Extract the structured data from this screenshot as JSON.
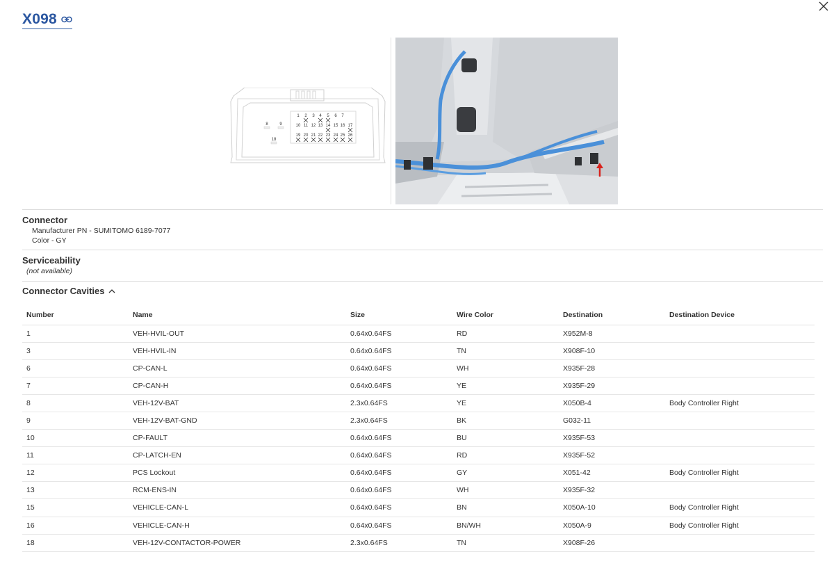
{
  "connector_id": "X098",
  "pinout": {
    "pins_top": [
      "1",
      "2",
      "3",
      "4",
      "5",
      "6",
      "7"
    ],
    "pins_mid": [
      "10",
      "11",
      "12",
      "13",
      "14",
      "15",
      "16",
      "17"
    ],
    "pins_bot": [
      "19",
      "20",
      "21",
      "22",
      "23",
      "24",
      "25",
      "26"
    ],
    "pins_left": [
      "8",
      "9",
      "18"
    ]
  },
  "connector_section": {
    "title": "Connector",
    "manufacturer_pn": "Manufacturer PN - SUMITOMO 6189-7077",
    "color": "Color - GY"
  },
  "serviceability_section": {
    "title": "Serviceability",
    "value": "(not available)"
  },
  "cavities": {
    "title": "Connector Cavities",
    "columns": [
      "Number",
      "Name",
      "Size",
      "Wire Color",
      "Destination",
      "Destination Device"
    ],
    "rows": [
      {
        "number": "1",
        "name": "VEH-HVIL-OUT",
        "size": "0.64x0.64FS",
        "wire_color": "RD",
        "destination": "X952M-8",
        "device": ""
      },
      {
        "number": "3",
        "name": "VEH-HVIL-IN",
        "size": "0.64x0.64FS",
        "wire_color": "TN",
        "destination": "X908F-10",
        "device": ""
      },
      {
        "number": "6",
        "name": "CP-CAN-L",
        "size": "0.64x0.64FS",
        "wire_color": "WH",
        "destination": "X935F-28",
        "device": ""
      },
      {
        "number": "7",
        "name": "CP-CAN-H",
        "size": "0.64x0.64FS",
        "wire_color": "YE",
        "destination": "X935F-29",
        "device": ""
      },
      {
        "number": "8",
        "name": "VEH-12V-BAT",
        "size": "2.3x0.64FS",
        "wire_color": "YE",
        "destination": "X050B-4",
        "device": "Body Controller Right"
      },
      {
        "number": "9",
        "name": "VEH-12V-BAT-GND",
        "size": "2.3x0.64FS",
        "wire_color": "BK",
        "destination": "G032-11",
        "device": ""
      },
      {
        "number": "10",
        "name": "CP-FAULT",
        "size": "0.64x0.64FS",
        "wire_color": "BU",
        "destination": "X935F-53",
        "device": ""
      },
      {
        "number": "11",
        "name": "CP-LATCH-EN",
        "size": "0.64x0.64FS",
        "wire_color": "RD",
        "destination": "X935F-52",
        "device": ""
      },
      {
        "number": "12",
        "name": "PCS Lockout",
        "size": "0.64x0.64FS",
        "wire_color": "GY",
        "destination": "X051-42",
        "device": "Body Controller Right"
      },
      {
        "number": "13",
        "name": "RCM-ENS-IN",
        "size": "0.64x0.64FS",
        "wire_color": "WH",
        "destination": "X935F-32",
        "device": ""
      },
      {
        "number": "15",
        "name": "VEHICLE-CAN-L",
        "size": "0.64x0.64FS",
        "wire_color": "BN",
        "destination": "X050A-10",
        "device": "Body Controller Right"
      },
      {
        "number": "16",
        "name": "VEHICLE-CAN-H",
        "size": "0.64x0.64FS",
        "wire_color": "BN/WH",
        "destination": "X050A-9",
        "device": "Body Controller Right"
      },
      {
        "number": "18",
        "name": "VEH-12V-CONTACTOR-POWER",
        "size": "2.3x0.64FS",
        "wire_color": "TN",
        "destination": "X908F-26",
        "device": ""
      }
    ]
  },
  "colors": {
    "title_link": "#2a56a0",
    "harness": "#4a90d9",
    "arrow": "#d9231d"
  },
  "icons": [
    "close-icon",
    "link-icon",
    "chevron-up-icon"
  ]
}
